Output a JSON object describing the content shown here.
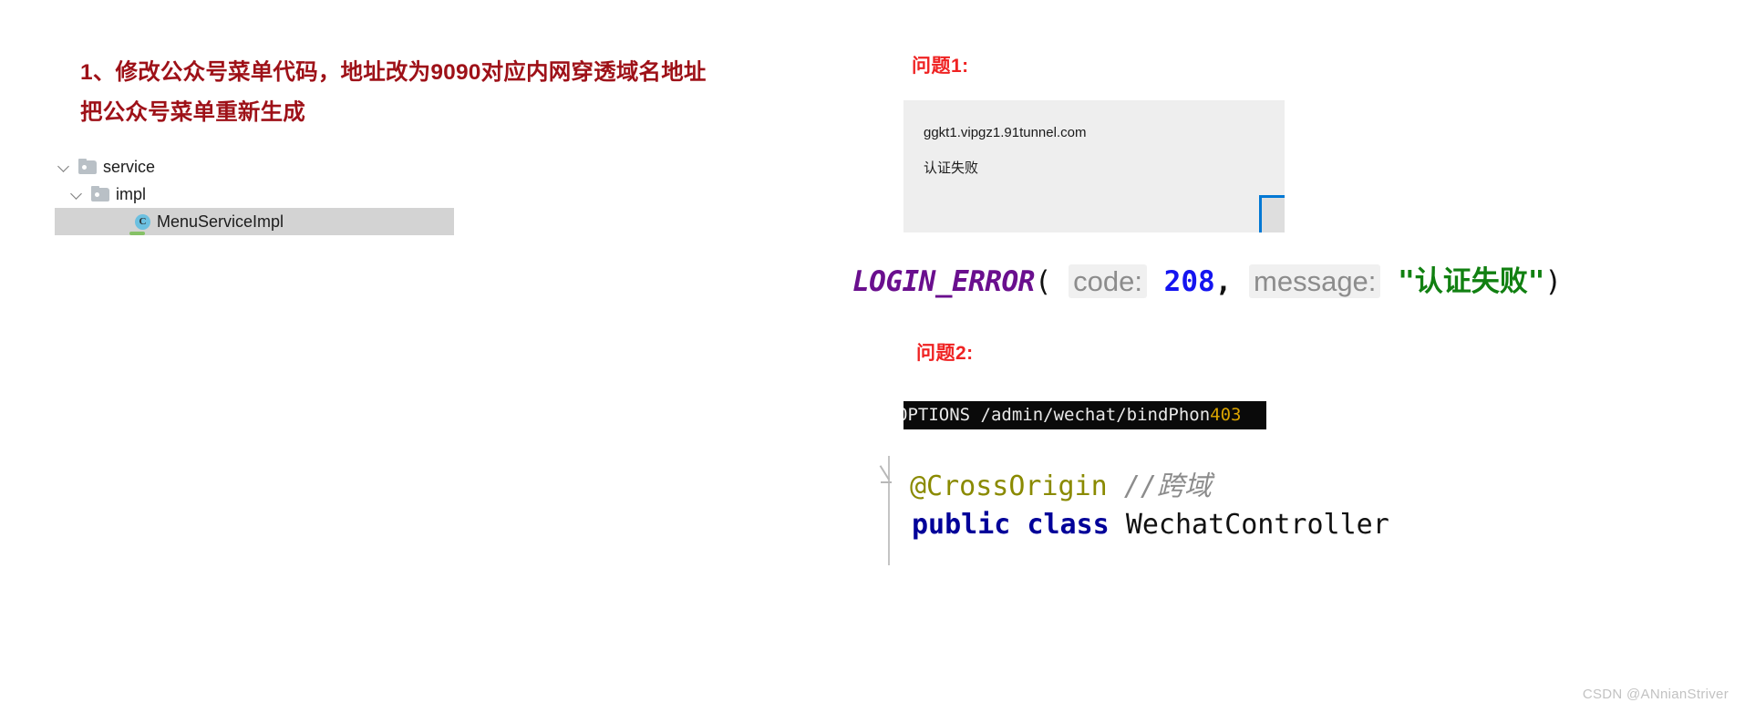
{
  "heading": {
    "line1": "1、修改公众号菜单代码，地址改为9090对应内网穿透域名地址",
    "line2": "把公众号菜单重新生成",
    "color": "#9e1118"
  },
  "file_tree": {
    "items": [
      {
        "label": "service",
        "type": "folder",
        "expanded": true,
        "depth": 0,
        "selected": false
      },
      {
        "label": "impl",
        "type": "folder",
        "expanded": true,
        "depth": 1,
        "selected": false
      },
      {
        "label": "MenuServiceImpl",
        "type": "class",
        "icon_letter": "C",
        "depth": 2,
        "selected": true
      }
    ],
    "selection_color": "#d3d3d3",
    "class_icon_color": "#6cc0e0"
  },
  "problem1": {
    "label": "问题1:",
    "label_color": "#ef2222",
    "dialog": {
      "domain": "ggkt1.vipgz1.91tunnel.com",
      "message": "认证失败",
      "background": "#eeeeee",
      "button_border": "#0078d4"
    },
    "code": {
      "constant": "LOGIN_ERROR",
      "open_paren": "(",
      "key_code": "code:",
      "value_code": "208",
      "comma": ",",
      "key_message": "message:",
      "value_message": "\"认证失败\"",
      "close_paren": ")",
      "colors": {
        "constant": "#6a0f8e",
        "key": "#8c8c8c",
        "number": "#1414f0",
        "string": "#118011"
      }
    }
  },
  "problem2": {
    "label": "问题2:",
    "label_color": "#ef2222",
    "terminal": {
      "request": "OPTIONS /admin/wechat/bindPhon",
      "status": "403",
      "background": "#0a0a0a",
      "text_color": "#e8e8e8",
      "status_color": "#d9a300"
    },
    "editor": {
      "annotation": "@CrossOrigin",
      "comment": "//跨域",
      "keyword_public": "public",
      "keyword_class": "class",
      "class_name": "WechatController",
      "colors": {
        "annotation": "#8a8a00",
        "comment": "#8c8c8c",
        "keyword": "#000099",
        "class_name": "#111111"
      }
    }
  },
  "watermark": {
    "text": "CSDN @ANnianStriver"
  }
}
